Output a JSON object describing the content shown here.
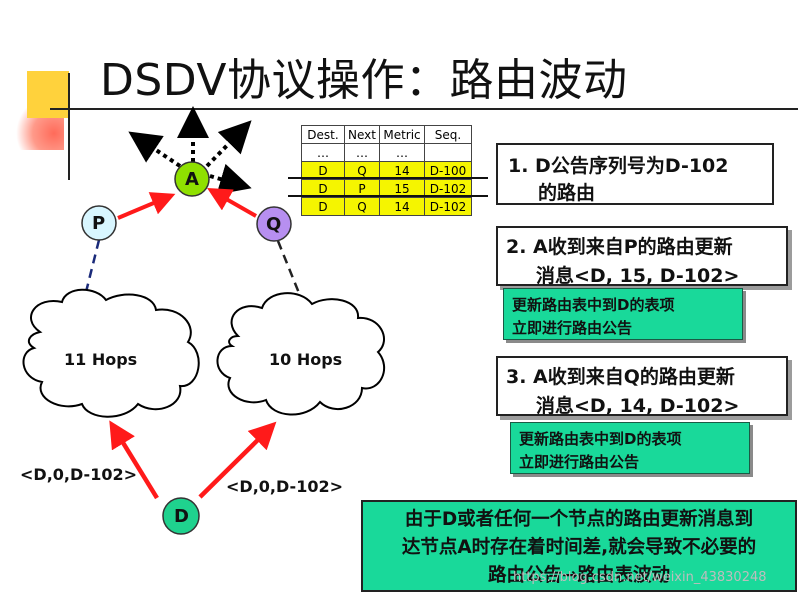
{
  "title": "DSDV协议操作：路由波动",
  "table": {
    "headers": [
      "Dest.",
      "Next",
      "Metric",
      "Seq."
    ],
    "rows": [
      [
        "…",
        "…",
        "…",
        ""
      ],
      [
        "D",
        "Q",
        "14",
        "D-100"
      ],
      [
        "D",
        "P",
        "15",
        "D-102"
      ],
      [
        "D",
        "Q",
        "14",
        "D-102"
      ]
    ]
  },
  "nodes": {
    "a": "A",
    "p": "P",
    "q": "Q",
    "d": "D"
  },
  "clouds": {
    "left": "11 Hops",
    "right": "10 Hops"
  },
  "edge_labels": {
    "left": "<D,0,D-102>",
    "right": "<D,0,D-102>"
  },
  "steps": {
    "s1": [
      "1. D公告序列号为D-102",
      "的路由"
    ],
    "s2": [
      "2. A收到来自P的路由更新",
      "消息<D, 15, D-102>"
    ],
    "s2_note": [
      "更新路由表中到D的表项",
      "立即进行路由公告"
    ],
    "s3": [
      "3. A收到来自Q的路由更新",
      "消息<D, 14, D-102>"
    ],
    "s3_note": [
      "更新路由表中到D的表项",
      "立即进行路由公告"
    ]
  },
  "summary": [
    "由于D或者任何一个节点的路由更新消息到",
    "达节点A时存在着时间差,就会导致不必要的",
    "路由公告→路由表波动"
  ],
  "watermark": "https://blog.csdn.net/weixin_43830248",
  "colors": {
    "accent_yellow": "#ffd23c",
    "table_highlight": "#f5f500",
    "note_green": "#19d99a",
    "node_a": "#8fe000",
    "node_p": "#d8f6ff",
    "node_q": "#b78ff0",
    "node_d": "#1fd28e",
    "arrow_red": "#ff1a1a"
  }
}
